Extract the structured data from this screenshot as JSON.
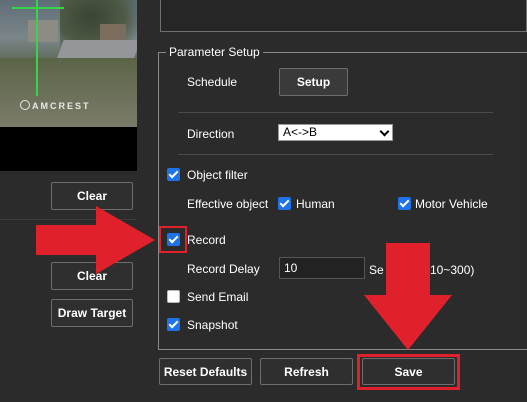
{
  "preview": {
    "logo_text": "AMCREST"
  },
  "left_panel": {
    "clear_button_1": "Clear",
    "clear_button_2": "Clear",
    "draw_target_button": "Draw Target"
  },
  "parameter_setup": {
    "legend": "Parameter Setup",
    "schedule_label": "Schedule",
    "setup_button": "Setup",
    "direction_label": "Direction",
    "direction_value": "A<->B",
    "object_filter_label": "Object filter",
    "object_filter_checked": true,
    "effective_object_label": "Effective object",
    "human_label": "Human",
    "human_checked": true,
    "motor_vehicle_label": "Motor Vehicle",
    "motor_vehicle_checked": true,
    "record_label": "Record",
    "record_checked": true,
    "record_delay_label": "Record Delay",
    "record_delay_value": "10",
    "record_delay_unit_start": "Se",
    "record_delay_unit_end": "10~300)",
    "send_email_label": "Send Email",
    "send_email_checked": false,
    "snapshot_label": "Snapshot",
    "snapshot_checked": true
  },
  "footer": {
    "reset_defaults_button": "Reset Defaults",
    "refresh_button": "Refresh",
    "save_button": "Save"
  },
  "colors": {
    "annotation_red": "#e0202a",
    "checkbox_blue": "#1f73e8",
    "background": "#2b2b2b"
  }
}
